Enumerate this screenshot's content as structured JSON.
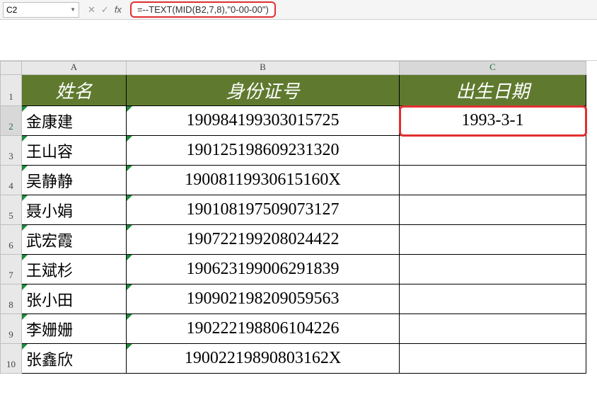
{
  "name_box": "C2",
  "formula": "=--TEXT(MID(B2,7,8),\"0-00-00\")",
  "columns": [
    "A",
    "B",
    "C"
  ],
  "headers": {
    "A": "姓名",
    "B": "身份证号",
    "C": "出生日期"
  },
  "rows": [
    {
      "n": 1
    },
    {
      "n": 2,
      "A": "金康建",
      "B": "190984199303015725",
      "C": "1993-3-1"
    },
    {
      "n": 3,
      "A": "王山容",
      "B": "190125198609231320",
      "C": ""
    },
    {
      "n": 4,
      "A": "吴静静",
      "B": "19008119930615160X",
      "C": ""
    },
    {
      "n": 5,
      "A": "聂小娟",
      "B": "190108197509073127",
      "C": ""
    },
    {
      "n": 6,
      "A": "武宏霞",
      "B": "190722199208024422",
      "C": ""
    },
    {
      "n": 7,
      "A": "王斌杉",
      "B": "190623199006291839",
      "C": ""
    },
    {
      "n": 8,
      "A": "张小田",
      "B": "190902198209059563",
      "C": ""
    },
    {
      "n": 9,
      "A": "李姗姗",
      "B": "190222198806104226",
      "C": ""
    },
    {
      "n": 10,
      "A": "张鑫欣",
      "B": "19002219890803162X",
      "C": ""
    }
  ],
  "active_cell": {
    "row": 2,
    "col": "C"
  },
  "chart_data": {
    "type": "table",
    "title": "",
    "columns": [
      "姓名",
      "身份证号",
      "出生日期"
    ],
    "data": [
      [
        "金康建",
        "190984199303015725",
        "1993-3-1"
      ],
      [
        "王山容",
        "190125198609231320",
        ""
      ],
      [
        "吴静静",
        "19008119930615160X",
        ""
      ],
      [
        "聂小娟",
        "190108197509073127",
        ""
      ],
      [
        "武宏霞",
        "190722199208024422",
        ""
      ],
      [
        "王斌杉",
        "190623199006291839",
        ""
      ],
      [
        "张小田",
        "190902198209059563",
        ""
      ],
      [
        "李姗姗",
        "190222198806104226",
        ""
      ],
      [
        "张鑫欣",
        "19002219890803162X",
        ""
      ]
    ]
  }
}
